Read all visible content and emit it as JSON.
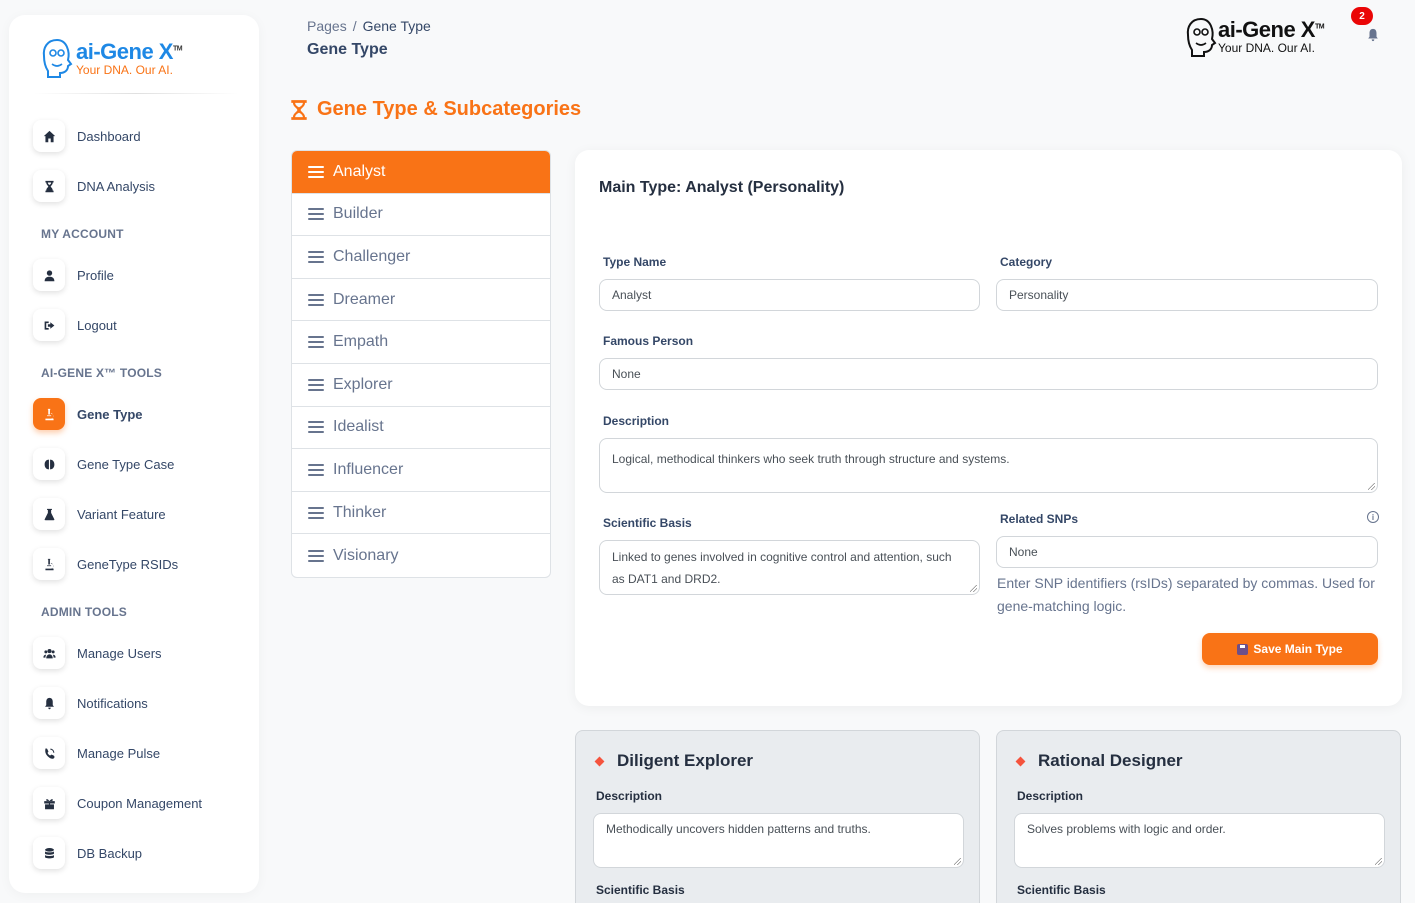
{
  "brand": {
    "name": "ai-Gene X",
    "tm": "TM",
    "tagline": "Your DNA. Our AI."
  },
  "sidebar": {
    "items": [
      {
        "label": "Dashboard",
        "icon": "home-icon"
      },
      {
        "label": "DNA Analysis",
        "icon": "hourglass-icon"
      },
      {
        "label": "Profile",
        "icon": "user-icon"
      },
      {
        "label": "Logout",
        "icon": "logout-icon"
      },
      {
        "label": "Gene Type",
        "icon": "microscope-icon"
      },
      {
        "label": "Gene Type Case",
        "icon": "brain-icon"
      },
      {
        "label": "Variant Feature",
        "icon": "flask-icon"
      },
      {
        "label": "GeneType RSIDs",
        "icon": "microscope-icon"
      },
      {
        "label": "Manage Users",
        "icon": "users-icon"
      },
      {
        "label": "Notifications",
        "icon": "bell-icon"
      },
      {
        "label": "Manage Pulse",
        "icon": "pulse-icon"
      },
      {
        "label": "Coupon Management",
        "icon": "gift-icon"
      },
      {
        "label": "DB Backup",
        "icon": "database-icon"
      }
    ],
    "sections": {
      "my_account": "MY ACCOUNT",
      "tools": "AI-GENE X™ TOOLS",
      "admin": "ADMIN TOOLS"
    }
  },
  "header": {
    "breadcrumb_root": "Pages",
    "breadcrumb_sep": "/",
    "breadcrumb_current": "Gene Type",
    "title": "Gene Type",
    "notification_count": "2"
  },
  "section_heading": "Gene Type & Subcategories",
  "types": [
    "Analyst",
    "Builder",
    "Challenger",
    "Dreamer",
    "Empath",
    "Explorer",
    "Idealist",
    "Influencer",
    "Thinker",
    "Visionary"
  ],
  "main": {
    "title": "Main Type: Analyst (Personality)",
    "type_name_label": "Type Name",
    "type_name_value": "Analyst",
    "category_label": "Category",
    "category_value": "Personality",
    "famous_label": "Famous Person",
    "famous_value": "None",
    "description_label": "Description",
    "description_value": "Logical, methodical thinkers who seek truth through structure and systems.",
    "scientific_label": "Scientific Basis",
    "scientific_value": "Linked to genes involved in cognitive control and attention, such as DAT1 and DRD2.",
    "snps_label": "Related SNPs",
    "snps_value": "None",
    "snps_help": "Enter SNP identifiers (rsIDs) separated by commas. Used for gene-matching logic.",
    "save_label": "Save Main Type"
  },
  "subtypes": [
    {
      "title": "Diligent Explorer",
      "description_label": "Description",
      "description": "Methodically uncovers hidden patterns and truths.",
      "scientific_label": "Scientific Basis"
    },
    {
      "title": "Rational Designer",
      "description_label": "Description",
      "description": "Solves problems with logic and order.",
      "scientific_label": "Scientific Basis"
    }
  ],
  "colors": {
    "accent": "#f97316",
    "text": "#344767",
    "muted": "#67748e"
  }
}
